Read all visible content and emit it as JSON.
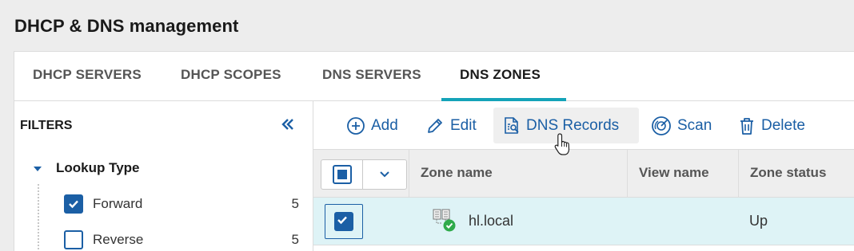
{
  "page": {
    "title": "DHCP & DNS management"
  },
  "tabs": [
    {
      "label": "DHCP SERVERS",
      "active": false
    },
    {
      "label": "DHCP SCOPES",
      "active": false
    },
    {
      "label": "DNS SERVERS",
      "active": false
    },
    {
      "label": "DNS ZONES",
      "active": true
    }
  ],
  "filters": {
    "title": "FILTERS",
    "collapse_icon": "double-chevron-left-icon",
    "group": {
      "title": "Lookup Type",
      "expanded": true,
      "items": [
        {
          "label": "Forward",
          "count": "5",
          "checked": true
        },
        {
          "label": "Reverse",
          "count": "5",
          "checked": false
        }
      ]
    }
  },
  "toolbar": {
    "add": "Add",
    "edit": "Edit",
    "dns_records": "DNS Records",
    "scan": "Scan",
    "delete": "Delete"
  },
  "grid": {
    "columns": [
      "Zone name",
      "View name",
      "Zone status"
    ],
    "rows": [
      {
        "zone_name": "hl.local",
        "view_name": "",
        "zone_status": "Up",
        "selected": true,
        "status_icon": "zone-up-check-icon"
      }
    ]
  },
  "colors": {
    "accent": "#1b5fa5",
    "tab_underline": "#14a3b8",
    "selected_row": "#def3f6",
    "status_ok": "#2eaa4a"
  }
}
